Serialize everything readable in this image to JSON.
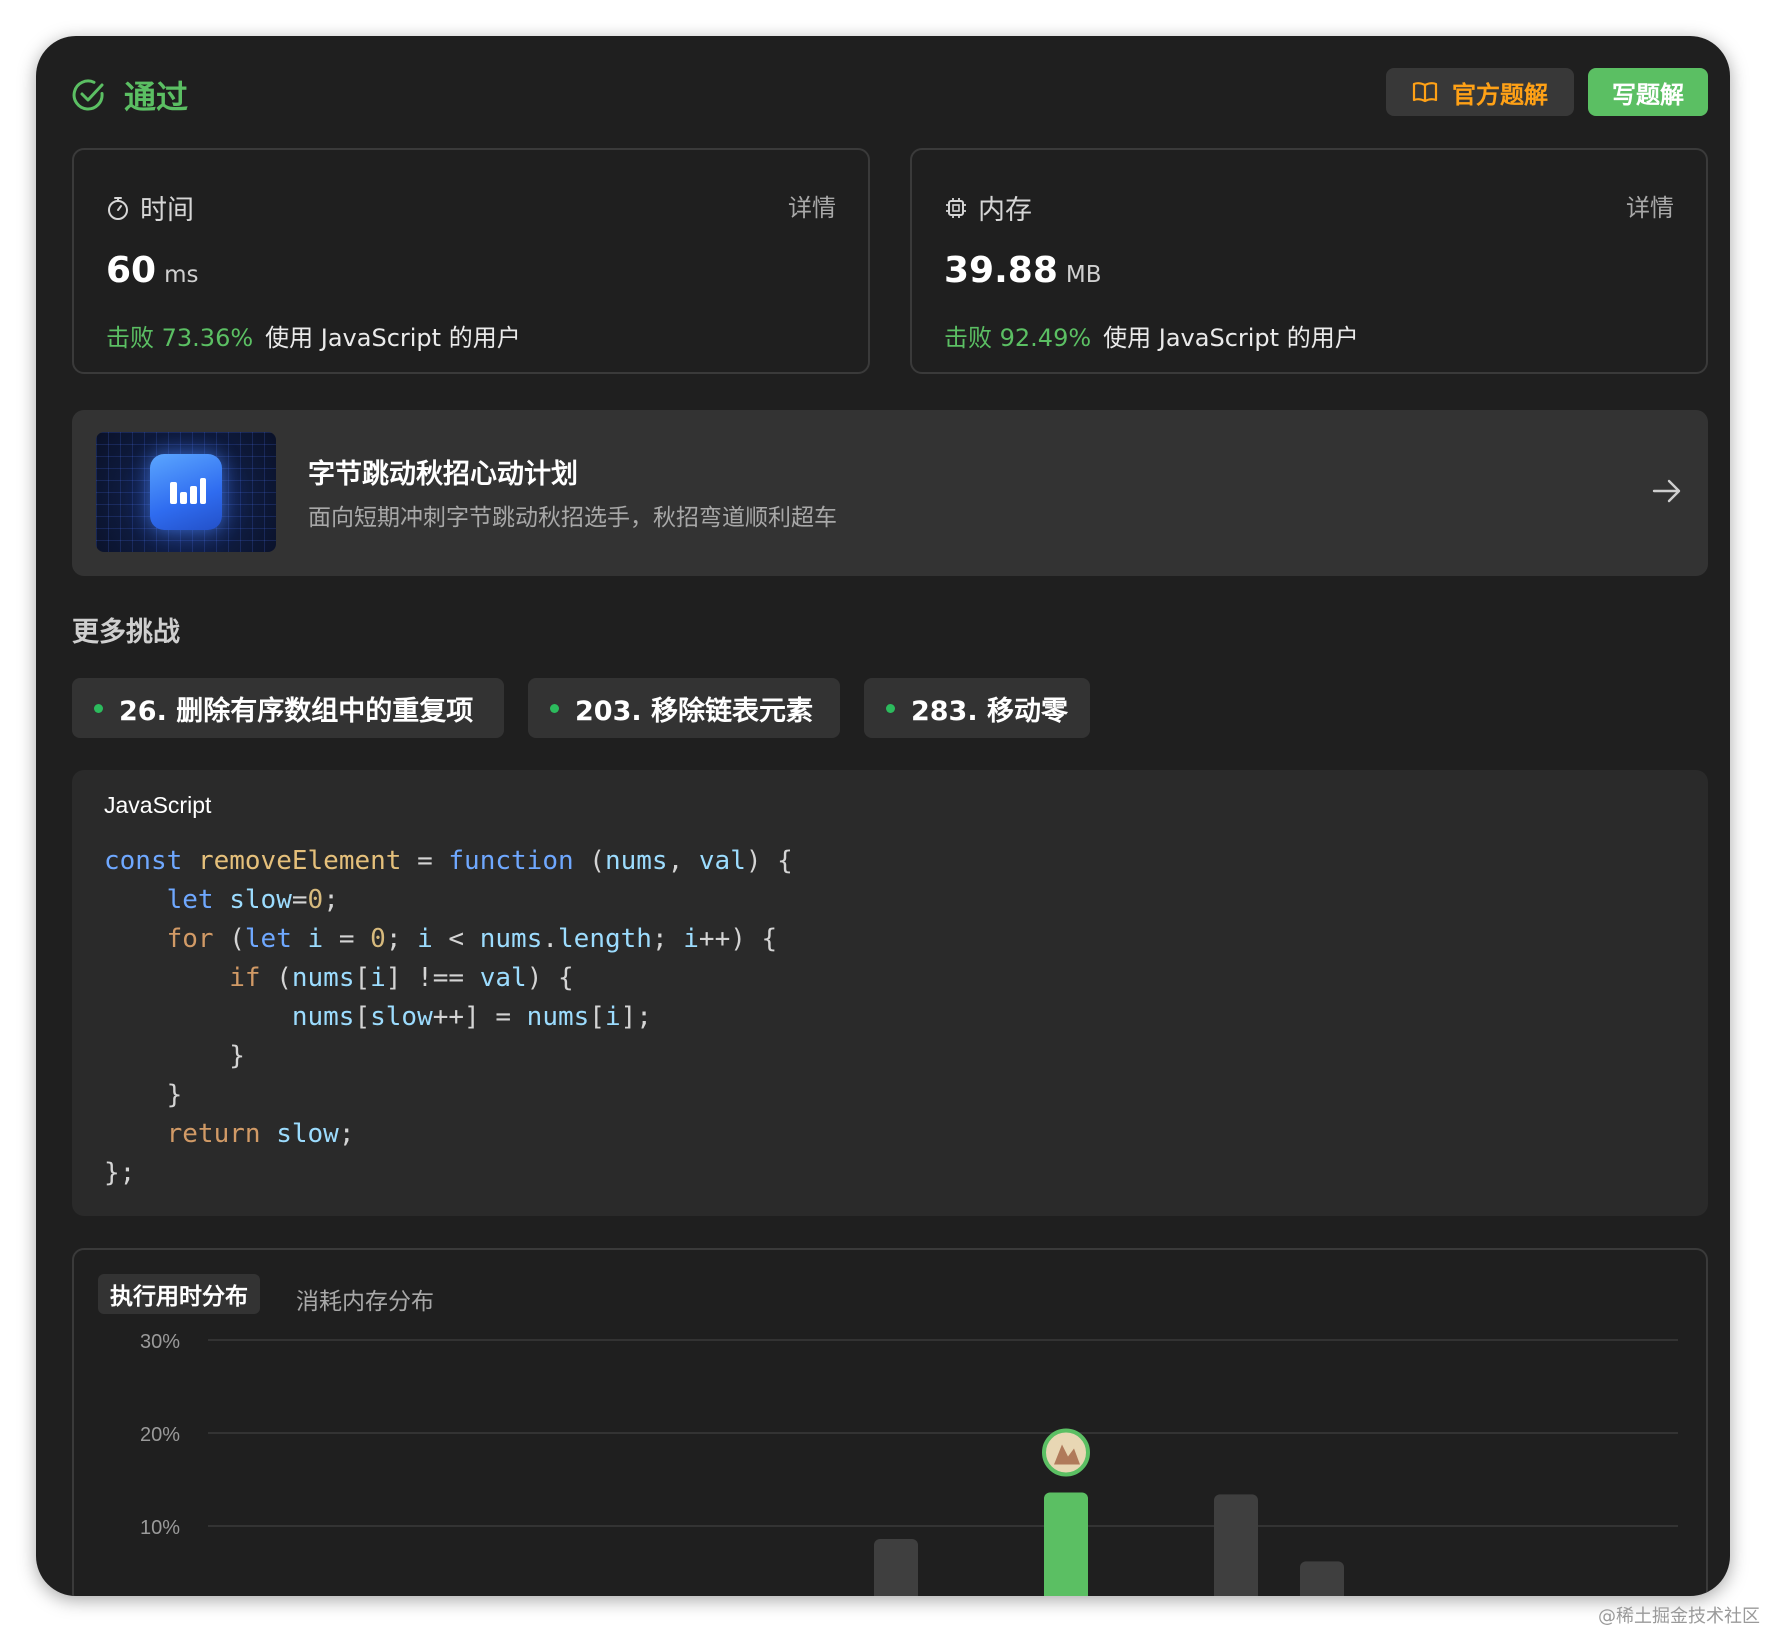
{
  "header": {
    "status": "通过",
    "solution_button": "官方题解",
    "write_button": "写题解"
  },
  "time_card": {
    "title": "时间",
    "detail": "详情",
    "value": "60",
    "unit": "ms",
    "beat_pct": "击败 73.36%",
    "beat_text": "使用 JavaScript 的用户"
  },
  "memory_card": {
    "title": "内存",
    "detail": "详情",
    "value": "39.88",
    "unit": "MB",
    "beat_pct": "击败 92.49%",
    "beat_text": "使用 JavaScript 的用户"
  },
  "banner": {
    "title": "字节跳动秋招心动计划",
    "subtitle": "面向短期冲刺字节跳动秋招选手，秋招弯道顺利超车"
  },
  "more": {
    "title": "更多挑战",
    "items": [
      "26. 删除有序数组中的重复项",
      "203. 移除链表元素",
      "283. 移动零"
    ]
  },
  "code": {
    "language": "JavaScript"
  },
  "chart": {
    "tabs": [
      "执行用时分布",
      "消耗内存分布"
    ],
    "active_tab": 0
  },
  "chart_data": {
    "type": "bar",
    "title": "",
    "xlabel": "",
    "ylabel": "",
    "ylim": [
      0,
      30
    ],
    "yticks": [
      "30%",
      "20%",
      "10%"
    ],
    "grid": true,
    "bars": [
      {
        "value": 0.2,
        "highlight": false
      },
      {
        "value": 8.6,
        "highlight": false
      },
      {
        "value": 13.6,
        "highlight": true
      },
      {
        "value": 13.4,
        "highlight": false
      },
      {
        "value": 6.2,
        "highlight": false
      },
      {
        "value": 0.4,
        "highlight": false
      }
    ],
    "colors": {
      "highlight": "#5bbf63",
      "normal": "#3f3f3f"
    }
  },
  "watermark": "@稀土掘金技术社区"
}
